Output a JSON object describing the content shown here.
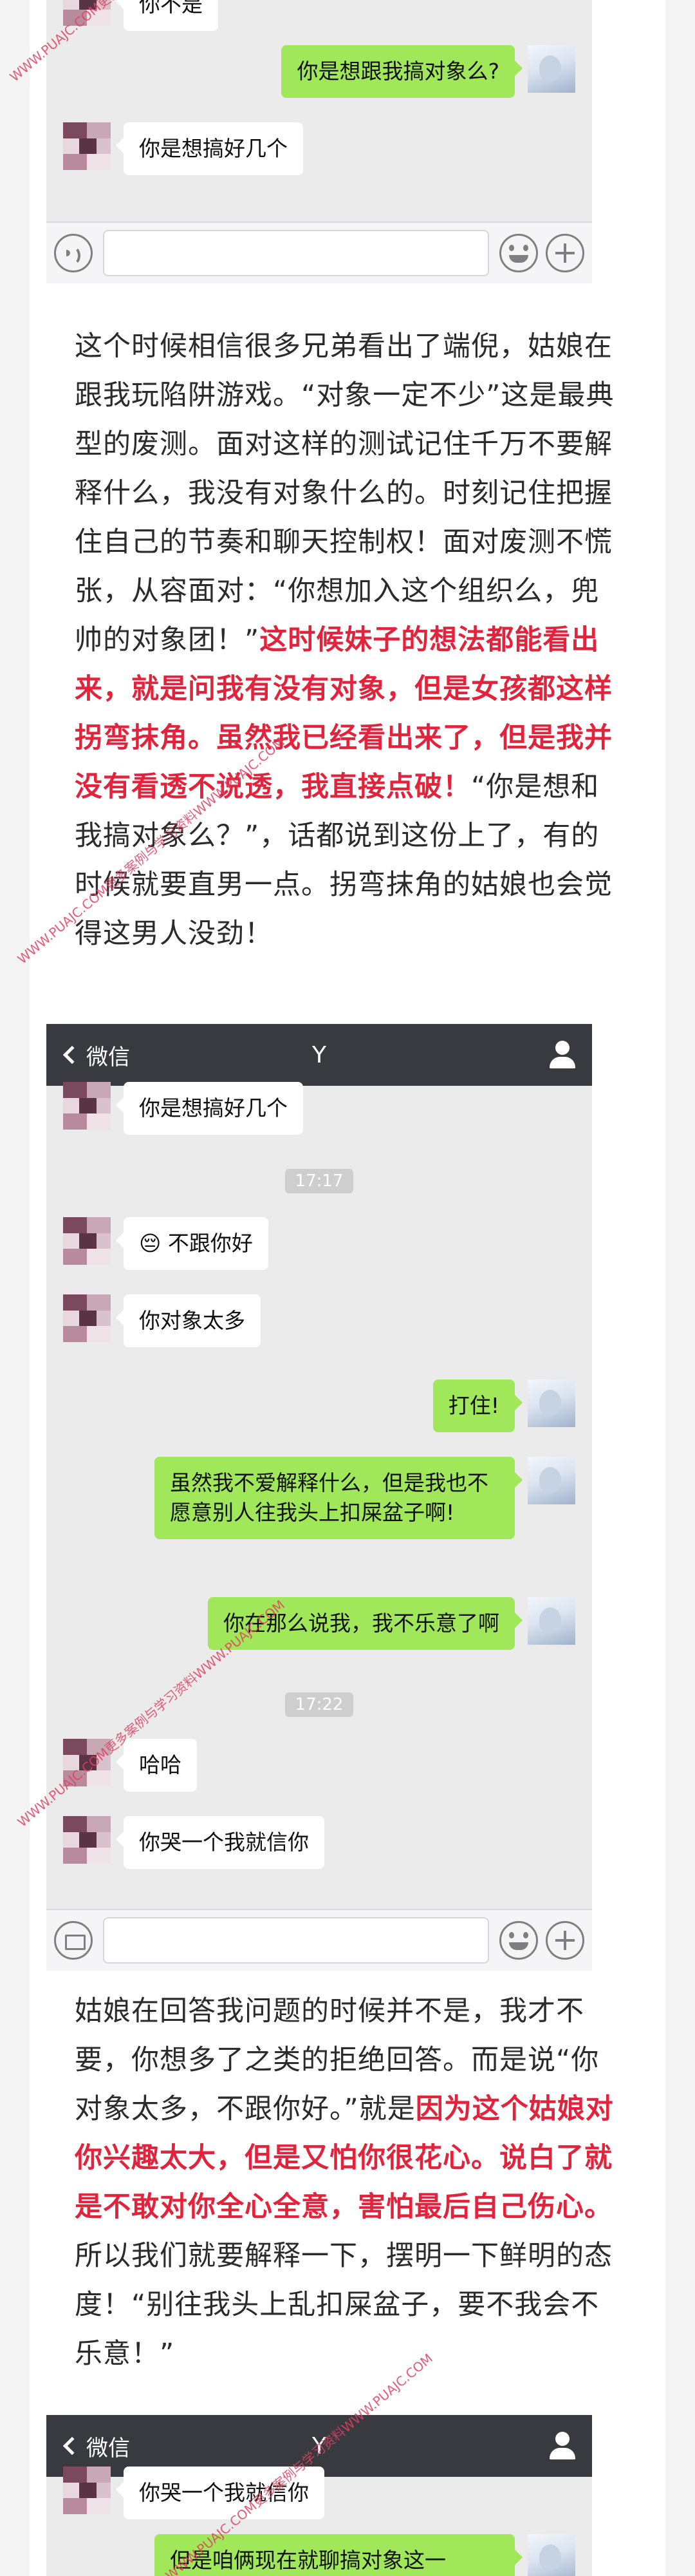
{
  "watermark_text": "WWW.PUAJC.COM更多案例与学习资料WWW.PUAJC.COM",
  "chat1": {
    "messages": [
      {
        "side": "left",
        "text": "你不是"
      },
      {
        "side": "right",
        "text": "你是想跟我搞对象么?"
      },
      {
        "side": "left",
        "text": "你是想搞好几个"
      }
    ]
  },
  "para1": {
    "text_a": "这个时候相信很多兄弟看出了端倪，姑娘在跟我玩陷阱游戏。“对象一定不少”这是最典型的废测。面对这样的测试记住千万不要解释什么，我没有对象什么的。时刻记住把握住自己的节奏和聊天控制权！面对废测不慌张，从容面对：“你想加入这个组织么，兜帅的对象团！”",
    "highlight": "这时候妹子的想法都能看出来，就是问我有没有对象，但是女孩都这样拐弯抹角。虽然我已经看出来了，但是我并没有看透不说透，我直接点破！",
    "text_b": "“你是想和我搞对象么？”，话都说到这份上了，有的时候就要直男一点。拐弯抹角的姑娘也会觉得这男人没劲！"
  },
  "chat2": {
    "back_label": "微信",
    "title": "Y",
    "messages": [
      {
        "side": "left",
        "text": "你是想搞好几个"
      },
      {
        "type": "time",
        "text": "17:17"
      },
      {
        "side": "left",
        "text": "😔 不跟你好"
      },
      {
        "side": "left",
        "text": "你对象太多"
      },
      {
        "side": "right",
        "text": "打住!"
      },
      {
        "side": "right",
        "text": "虽然我不爱解释什么，但是我也不愿意别人往我头上扣屎盆子啊!"
      },
      {
        "side": "right",
        "text": "你在那么说我，我不乐意了啊"
      },
      {
        "type": "time",
        "text": "17:22"
      },
      {
        "side": "left",
        "text": "哈哈"
      },
      {
        "side": "left",
        "text": "你哭一个我就信你"
      }
    ]
  },
  "para2": {
    "text_a": "姑娘在回答我问题的时候并不是，我才不要，你想多了之类的拒绝回答。而是说“你对象太多，不跟你好。”就是",
    "highlight": "因为这个姑娘对你兴趣太大，但是又怕你很花心。说白了就是不敢对你全心全意，害怕最后自己伤心。",
    "text_b": "所以我们就要解释一下，摆明一下鲜明的态度！“别往我头上乱扣屎盆子，要不我会不乐意！”"
  },
  "chat3": {
    "back_label": "微信",
    "title": "Y",
    "messages": [
      {
        "side": "left",
        "text": "你哭一个我就信你"
      },
      {
        "side": "right",
        "text": "但是咱俩现在就聊搞对象这一"
      }
    ]
  },
  "colors": {
    "green_bubble": "#a0e75a",
    "topbar": "#393a3f",
    "highlight": "#e2233c"
  }
}
